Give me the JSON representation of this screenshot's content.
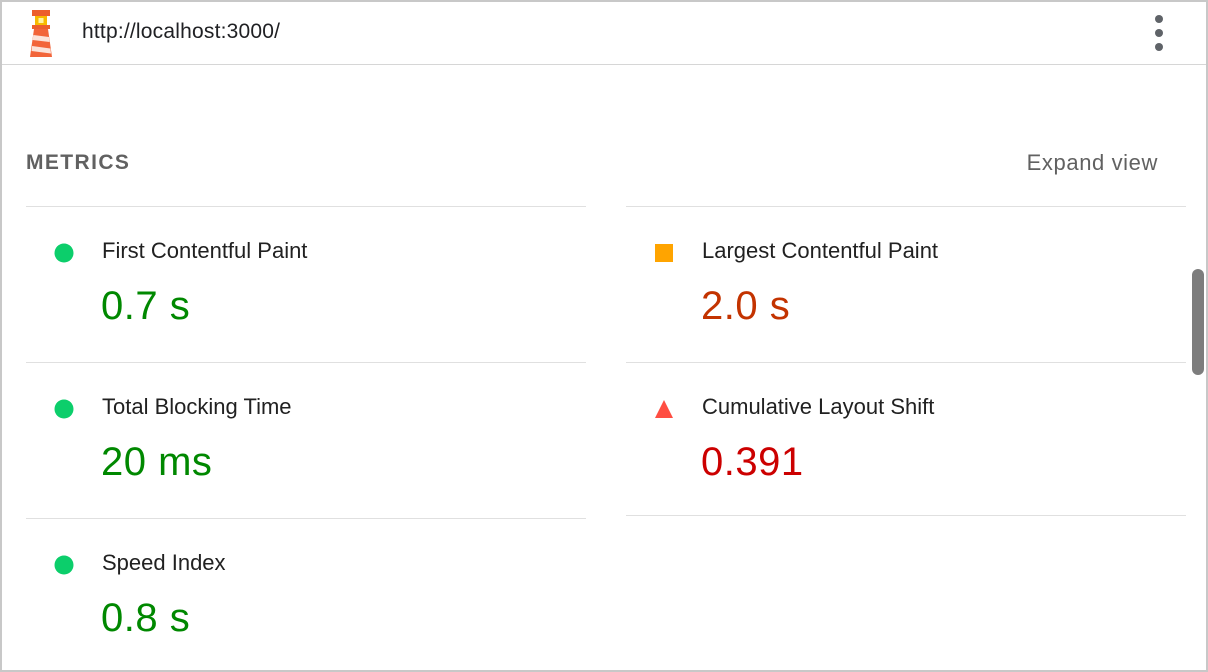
{
  "header": {
    "url": "http://localhost:3000/",
    "logo_icon": "lighthouse-icon",
    "menu_icon": "more-vertical-icon"
  },
  "section": {
    "title": "METRICS",
    "expand_label": "Expand view"
  },
  "colors": {
    "pass": "#0cce6b",
    "pass_text": "#008800",
    "average": "#ffa400",
    "average_text": "#c33300",
    "fail": "#ff4e42",
    "fail_text": "#cc0000"
  },
  "metrics": [
    {
      "label": "First Contentful Paint",
      "value": "0.7 s",
      "status": "pass",
      "indicator_icon": "pass-circle-icon"
    },
    {
      "label": "Largest Contentful Paint",
      "value": "2.0 s",
      "status": "average",
      "indicator_icon": "average-square-icon"
    },
    {
      "label": "Total Blocking Time",
      "value": "20 ms",
      "status": "pass",
      "indicator_icon": "pass-circle-icon"
    },
    {
      "label": "Cumulative Layout Shift",
      "value": "0.391",
      "status": "fail",
      "indicator_icon": "fail-triangle-icon"
    },
    {
      "label": "Speed Index",
      "value": "0.8 s",
      "status": "pass",
      "indicator_icon": "pass-circle-icon"
    }
  ]
}
